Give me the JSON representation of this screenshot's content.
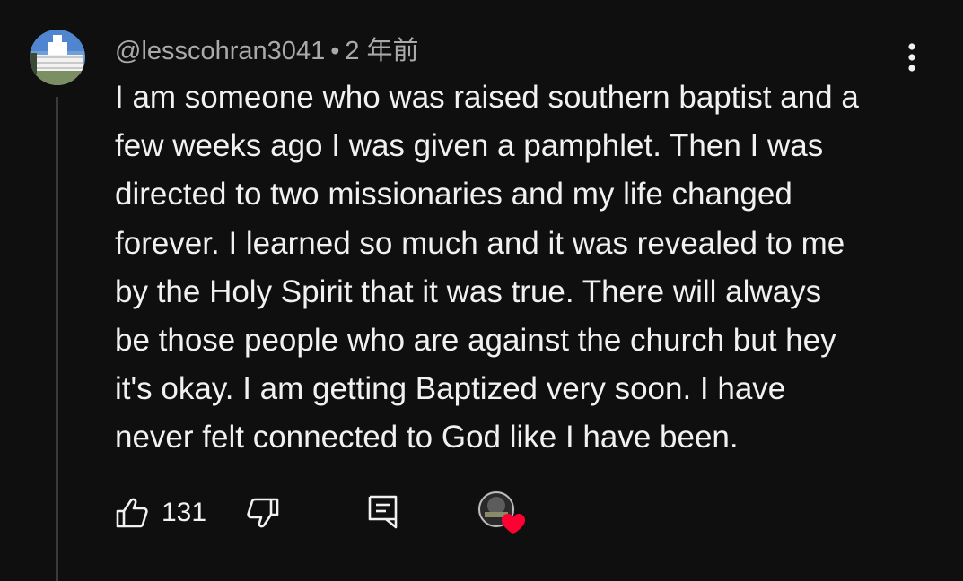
{
  "comment": {
    "author": "@lesscohran3041",
    "separator": "•",
    "timestamp": "2 年前",
    "text_lines": [
      "I am someone who was raised southern baptist and a",
      "few weeks ago I was given a pamphlet. Then I was",
      "directed to two missionaries and my life changed",
      "forever. I learned so much and it was revealed to me",
      "by the Holy Spirit that it was true. There will always",
      "be those people who are against the church but hey",
      "it's okay. I am getting Baptized very soon. I have",
      "never felt connected to God like I have been."
    ],
    "like_count": "131",
    "hearted_by_creator": true
  },
  "icons": {
    "more": "more-vertical-icon",
    "like": "thumbs-up-icon",
    "dislike": "thumbs-down-icon",
    "reply": "reply-comment-icon",
    "heart": "heart-icon"
  },
  "colors": {
    "background": "#0f0f0f",
    "text": "#f1f1f1",
    "meta": "#aaaaaa",
    "heart": "#ff0033",
    "thread_line": "#3a3a3a"
  }
}
